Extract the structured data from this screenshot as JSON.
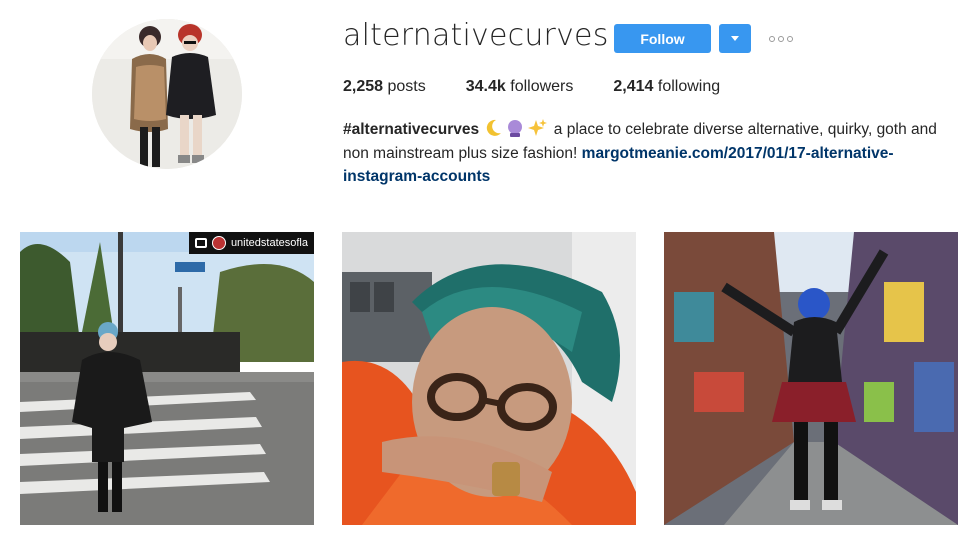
{
  "profile": {
    "username": "alternativecurves",
    "follow_label": "Follow"
  },
  "stats": {
    "posts_count": "2,258",
    "posts_label": "posts",
    "followers_count": "34.4k",
    "followers_label": "followers",
    "following_count": "2,414",
    "following_label": "following"
  },
  "bio": {
    "hashtag": "#alternativecurves",
    "emojis": [
      "crescent-moon",
      "crystal-ball",
      "sparkles"
    ],
    "text": "a place to celebrate diverse alternative, quirky, goth and non mainstream plus size fashion!",
    "link": "margotmeanie.com/2017/01/17-alternative-instagram-accounts"
  },
  "posts": [
    {
      "repost_user": "unitedstatesofla"
    },
    {},
    {}
  ],
  "colors": {
    "accent": "#3897f0",
    "link": "#003569"
  }
}
